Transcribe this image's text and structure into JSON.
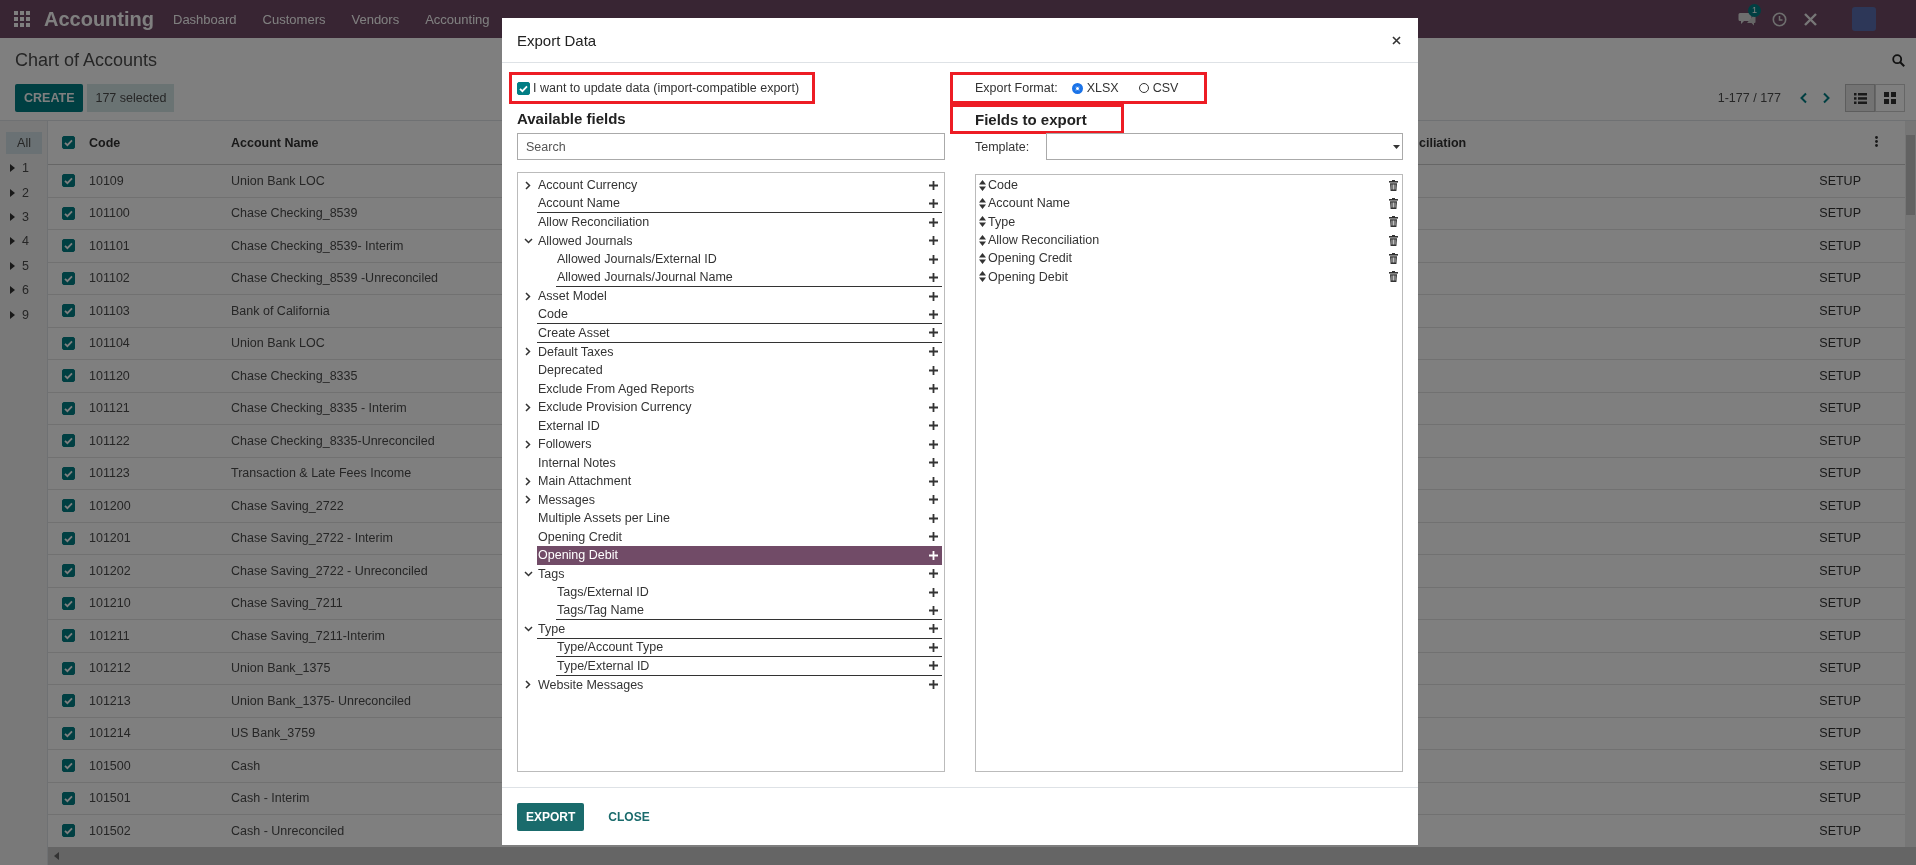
{
  "navbar": {
    "app_name": "Accounting",
    "menu": [
      "Dashboard",
      "Customers",
      "Vendors",
      "Accounting"
    ],
    "chat_badge": "1"
  },
  "control_panel": {
    "title": "Chart of Accounts",
    "create_button": "CREATE",
    "selection": "177 selected",
    "pager": "1-177 / 177",
    "views": [
      {
        "kind": "list",
        "selected": true
      },
      {
        "kind": "kanban",
        "selected": false
      }
    ]
  },
  "search_panel": {
    "items": [
      {
        "label": "All",
        "expandable": false,
        "selected": true
      },
      {
        "label": "1",
        "expandable": true,
        "selected": false
      },
      {
        "label": "2",
        "expandable": true,
        "selected": false
      },
      {
        "label": "3",
        "expandable": true,
        "selected": false
      },
      {
        "label": "4",
        "expandable": true,
        "selected": false
      },
      {
        "label": "5",
        "expandable": true,
        "selected": false
      },
      {
        "label": "6",
        "expandable": true,
        "selected": false
      },
      {
        "label": "9",
        "expandable": true,
        "selected": false
      }
    ]
  },
  "list": {
    "all_selected": true,
    "columns": [
      "Code",
      "Account Name",
      "ciliation"
    ],
    "rows": [
      {
        "code": "10109",
        "name": "Union Bank LOC",
        "action": "SETUP",
        "selected": true
      },
      {
        "code": "101100",
        "name": "Chase Checking_8539",
        "action": "SETUP",
        "selected": true
      },
      {
        "code": "101101",
        "name": "Chase Checking_8539- Interim",
        "action": "SETUP",
        "selected": true
      },
      {
        "code": "101102",
        "name": "Chase Checking_8539 -Unreconciled",
        "action": "SETUP",
        "selected": true
      },
      {
        "code": "101103",
        "name": "Bank of California",
        "action": "SETUP",
        "selected": true
      },
      {
        "code": "101104",
        "name": "Union Bank LOC",
        "action": "SETUP",
        "selected": true
      },
      {
        "code": "101120",
        "name": "Chase Checking_8335",
        "action": "SETUP",
        "selected": true
      },
      {
        "code": "101121",
        "name": "Chase Checking_8335 - Interim",
        "action": "SETUP",
        "selected": true
      },
      {
        "code": "101122",
        "name": "Chase Checking_8335-Unreconciled",
        "action": "SETUP",
        "selected": true
      },
      {
        "code": "101123",
        "name": "Transaction & Late Fees Income",
        "action": "SETUP",
        "selected": true
      },
      {
        "code": "101200",
        "name": "Chase Saving_2722",
        "action": "SETUP",
        "selected": true
      },
      {
        "code": "101201",
        "name": "Chase Saving_2722 - Interim",
        "action": "SETUP",
        "selected": true
      },
      {
        "code": "101202",
        "name": "Chase Saving_2722 - Unreconciled",
        "action": "SETUP",
        "selected": true
      },
      {
        "code": "101210",
        "name": "Chase Saving_7211",
        "action": "SETUP",
        "selected": true
      },
      {
        "code": "101211",
        "name": "Chase Saving_7211-Interim",
        "action": "SETUP",
        "selected": true
      },
      {
        "code": "101212",
        "name": "Union Bank_1375",
        "action": "SETUP",
        "selected": true
      },
      {
        "code": "101213",
        "name": "Union Bank_1375- Unreconciled",
        "action": "SETUP",
        "selected": true
      },
      {
        "code": "101214",
        "name": "US Bank_3759",
        "action": "SETUP",
        "selected": true
      },
      {
        "code": "101500",
        "name": "Cash",
        "action": "SETUP",
        "selected": true
      },
      {
        "code": "101501",
        "name": "Cash - Interim",
        "action": "SETUP",
        "selected": true
      },
      {
        "code": "101502",
        "name": "Cash - Unreconciled",
        "action": "SETUP",
        "selected": true
      }
    ]
  },
  "dialog": {
    "title": "Export Data",
    "import_compatible": {
      "label": "I want to update data (import-compatible export)",
      "checked": true,
      "highlighted": true
    },
    "available_fields": {
      "heading": "Available fields",
      "search": {
        "placeholder": "Search"
      },
      "items": [
        {
          "label": "Account Currency",
          "kind": "relation",
          "expanded": false,
          "selected": false,
          "underlined": false
        },
        {
          "label": "Account Name",
          "kind": "field",
          "selected": false,
          "underlined": true
        },
        {
          "label": "Allow Reconciliation",
          "kind": "field",
          "selected": false,
          "underlined": false
        },
        {
          "label": "Allowed Journals",
          "kind": "relation",
          "expanded": true,
          "selected": false,
          "underlined": false,
          "children": [
            {
              "label": "Allowed Journals/External ID",
              "kind": "field",
              "selected": false,
              "underlined": false
            },
            {
              "label": "Allowed Journals/Journal Name",
              "kind": "field",
              "selected": false,
              "underlined": true
            }
          ]
        },
        {
          "label": "Asset Model",
          "kind": "relation",
          "expanded": false,
          "selected": false,
          "underlined": false
        },
        {
          "label": "Code",
          "kind": "field",
          "selected": false,
          "underlined": true
        },
        {
          "label": "Create Asset",
          "kind": "field",
          "selected": false,
          "underlined": true
        },
        {
          "label": "Default Taxes",
          "kind": "relation",
          "expanded": false,
          "selected": false,
          "underlined": false
        },
        {
          "label": "Deprecated",
          "kind": "field",
          "selected": false,
          "underlined": false
        },
        {
          "label": "Exclude From Aged Reports",
          "kind": "field",
          "selected": false,
          "underlined": false
        },
        {
          "label": "Exclude Provision Currency",
          "kind": "relation",
          "expanded": false,
          "selected": false,
          "underlined": false
        },
        {
          "label": "External ID",
          "kind": "field",
          "selected": false,
          "underlined": false
        },
        {
          "label": "Followers",
          "kind": "relation",
          "expanded": false,
          "selected": false,
          "underlined": false
        },
        {
          "label": "Internal Notes",
          "kind": "field",
          "selected": false,
          "underlined": false
        },
        {
          "label": "Main Attachment",
          "kind": "relation",
          "expanded": false,
          "selected": false,
          "underlined": false
        },
        {
          "label": "Messages",
          "kind": "relation",
          "expanded": false,
          "selected": false,
          "underlined": false
        },
        {
          "label": "Multiple Assets per Line",
          "kind": "field",
          "selected": false,
          "underlined": false
        },
        {
          "label": "Opening Credit",
          "kind": "field",
          "selected": false,
          "underlined": false
        },
        {
          "label": "Opening Debit",
          "kind": "field",
          "selected": true,
          "underlined": false
        },
        {
          "label": "Tags",
          "kind": "relation",
          "expanded": true,
          "selected": false,
          "underlined": false,
          "children": [
            {
              "label": "Tags/External ID",
              "kind": "field",
              "selected": false,
              "underlined": false
            },
            {
              "label": "Tags/Tag Name",
              "kind": "field",
              "selected": false,
              "underlined": true
            }
          ]
        },
        {
          "label": "Type",
          "kind": "relation",
          "expanded": true,
          "selected": false,
          "underlined": true,
          "children": [
            {
              "label": "Type/Account Type",
              "kind": "field",
              "selected": false,
              "underlined": true
            },
            {
              "label": "Type/External ID",
              "kind": "field",
              "selected": false,
              "underlined": true
            }
          ]
        },
        {
          "label": "Website Messages",
          "kind": "relation",
          "expanded": false,
          "selected": false,
          "underlined": false
        }
      ]
    },
    "export_format": {
      "label": "Export Format:",
      "highlighted": true,
      "options": [
        {
          "label": "XLSX",
          "selected": true
        },
        {
          "label": "CSV",
          "selected": false
        }
      ]
    },
    "fields_to_export": {
      "heading": "Fields to export",
      "highlighted": true,
      "template_label": "Template:",
      "fields": [
        "Code",
        "Account Name",
        "Type",
        "Allow Reconciliation",
        "Opening Credit",
        "Opening Debit"
      ]
    },
    "buttons": {
      "export": "EXPORT",
      "close": "CLOSE"
    }
  }
}
